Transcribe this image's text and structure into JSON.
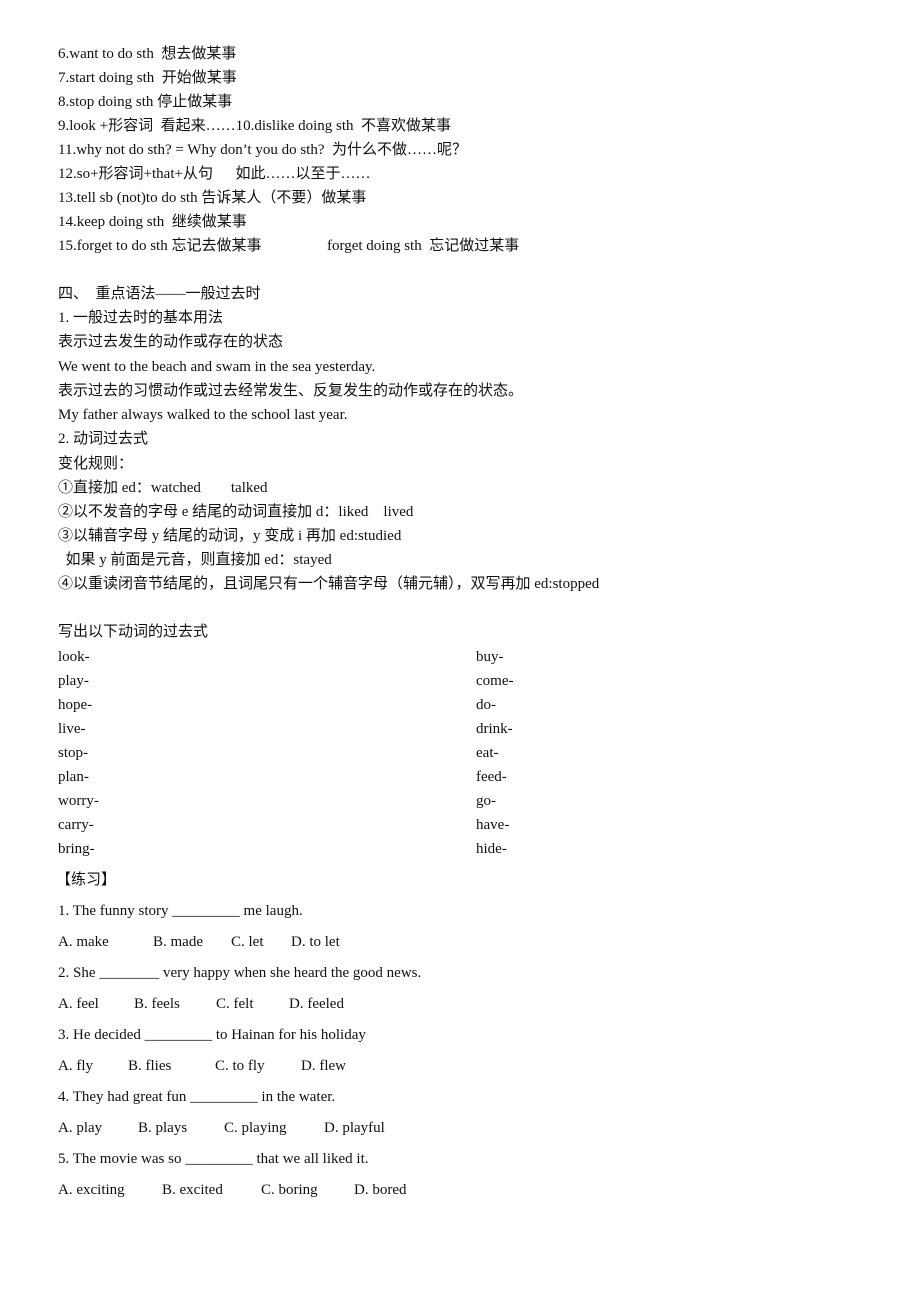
{
  "phrases": [
    {
      "num": "6.want to do sth",
      "meaning": "想去做某事"
    },
    {
      "num": "7.start doing sth",
      "meaning": "开始做某事"
    },
    {
      "num": "8.stop doing sth",
      "meaning": "停止做某事"
    },
    {
      "num": "9.look +形容词",
      "meaning": "看起来……10.dislike doing sth  不喜欢做某事"
    },
    {
      "num": "11.why not do sth? = Why don’t you do sth?",
      "meaning": "为什么不做……呢？"
    },
    {
      "num": "12.so+形容词+that+从句",
      "meaning": "如此……以至于……"
    },
    {
      "num": "13.tell sb (not)to do sth",
      "meaning": "告诉某人（不要）做某事"
    },
    {
      "num": "14.keep doing sth",
      "meaning": "继续做某事"
    },
    {
      "num": "15.forget to do sth",
      "meaning": "忘记去做某事"
    }
  ],
  "phrase15_extra": "forget doing sth  忘记做过某事",
  "grammar": {
    "heading": "四、  重点语法——一般过去时",
    "sub1": "1. 一般过去时的基本用法",
    "use1": "表示过去发生的动作或存在的状态",
    "example1": "We went to the beach and swam in the sea yesterday.",
    "use2": "表示过去的习惯动作或过去经常发生、反复发生的动作或存在的状态。",
    "example2": "My father always walked to the school last year.",
    "sub2": "2. 动词过去式",
    "rules_label": "变化规则：",
    "rules": [
      "①直接加 ed：watched        talked",
      "②以不发音的字母 e 结尾的动词直接加 d：liked    lived",
      "③以辅音字母 y 结尾的动词，y 变成 i 再加 ed:studied",
      "  如果 y 前面是元音，则直接加 ed：stayed",
      "④以重读闭音节结尾的，且词尾只有一个辅音字母（辅元辅），双写再加 ed:stopped"
    ]
  },
  "verbs": {
    "title": "写出以下动词的过去式",
    "left": [
      "look-",
      "play-",
      "hope-",
      "live-",
      "stop-",
      "plan-",
      "worry-",
      "carry-",
      "bring-"
    ],
    "right": [
      "buy-",
      "come-",
      "do-",
      "drink-",
      "eat-",
      "feed-",
      "go-",
      "have-",
      "hide-"
    ]
  },
  "exercise": {
    "title": "【练习】",
    "questions": [
      {
        "q": "1. The funny story _________ me laugh.",
        "options": [
          "A. make",
          "B. made",
          "C. let",
          "D. to let"
        ]
      },
      {
        "q": "2. She ________ very happy when she heard the good news.",
        "options": [
          "A. feel",
          "B. feels",
          "C. felt",
          "D. feeled"
        ]
      },
      {
        "q": "3. He decided _________ to Hainan for his holiday",
        "options": [
          "A. fly",
          "B. flies",
          "C. to fly",
          "D. flew"
        ]
      },
      {
        "q": "4. They had great fun _________ in the water.",
        "options": [
          "A. play",
          "B. plays",
          "C. playing",
          "D. playful"
        ]
      },
      {
        "q": "5. The movie was so _________ that we all liked it.",
        "options": [
          "A. exciting",
          "B. excited",
          "C. boring",
          "D. bored"
        ]
      }
    ]
  }
}
